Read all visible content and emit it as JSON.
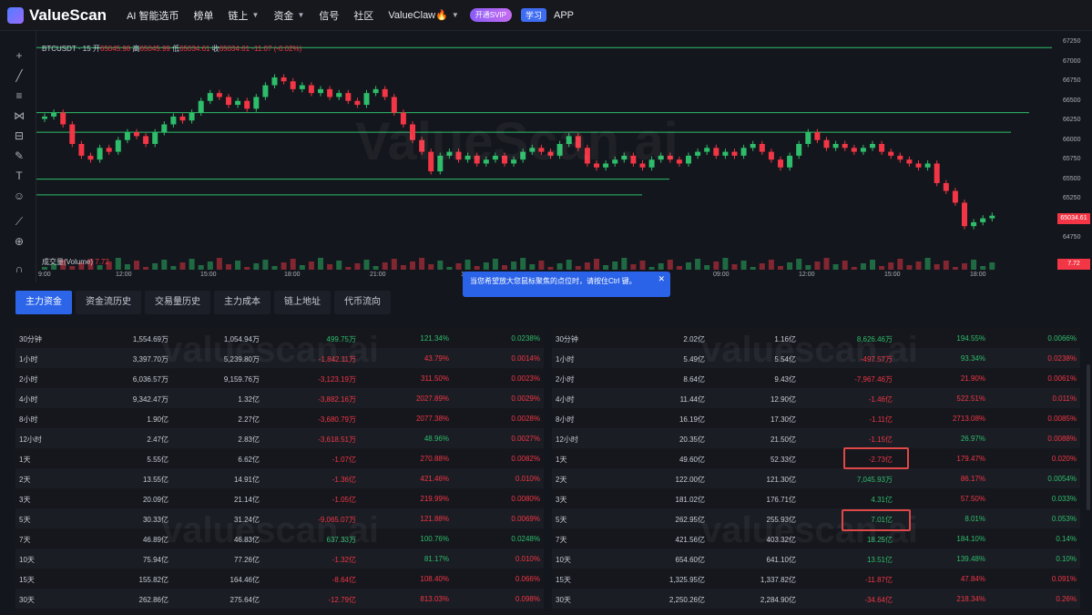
{
  "nav": {
    "logo": "ValueScan",
    "items": [
      "AI 智能选币",
      "榜单",
      "链上",
      "资金",
      "信号",
      "社区",
      "ValueClaw🔥"
    ],
    "vip": "开通SVIP",
    "learn": "学习",
    "app": "APP"
  },
  "chart": {
    "symbol": "BTCUSDT · 15",
    "open_label": "开",
    "open": "65045.98",
    "high_label": "高",
    "high": "65045.99",
    "low_label": "低",
    "low": "65034.61",
    "close_label": "收",
    "close": "65034.61",
    "change": "-11.07 (-0.02%)",
    "volume_label": "成交量(Volume)",
    "volume_value": "7.72",
    "watermark": "ValueScan.ai",
    "last_price": "65034.61",
    "vol_tag": "7.72",
    "x_ticks": [
      "9:00",
      "12:00",
      "15:00",
      "18:00",
      "21:00",
      "17",
      "03:00",
      "06:00",
      "09:00",
      "12:00",
      "15:00",
      "18:00"
    ],
    "y_ticks": [
      "67250",
      "67000",
      "66750",
      "66500",
      "66250",
      "66000",
      "65750",
      "65500",
      "65250",
      "64750"
    ],
    "tooltip": "当您希望放大您鼠标聚焦的点位时，请按住Ctrl 键。"
  },
  "chart_data": {
    "type": "candlestick",
    "ylim": [
      64600,
      67300
    ],
    "candles_close": [
      66300,
      66350,
      66200,
      65950,
      65800,
      65750,
      65900,
      65850,
      66000,
      66100,
      66050,
      65950,
      66100,
      66200,
      66300,
      66250,
      66350,
      66500,
      66600,
      66550,
      66450,
      66500,
      66400,
      66550,
      66700,
      66800,
      66750,
      66650,
      66700,
      66600,
      66650,
      66550,
      66600,
      66500,
      66450,
      66600,
      66650,
      66550,
      66350,
      66200,
      66000,
      65850,
      65600,
      65800,
      65850,
      65750,
      65800,
      65700,
      65750,
      65800,
      65700,
      65750,
      65850,
      65900,
      65850,
      65800,
      65950,
      66050,
      65900,
      65700,
      65650,
      65700,
      65750,
      65800,
      65700,
      65650,
      65750,
      65800,
      65750,
      65700,
      65800,
      65850,
      65900,
      65800,
      65850,
      65800,
      65900,
      65950,
      65850,
      65750,
      65650,
      65800,
      65950,
      66100,
      66000,
      65900,
      65950,
      65900,
      65850,
      65900,
      65950,
      65850,
      65800,
      65750,
      65700,
      65650,
      65700,
      65450,
      65350,
      65200,
      64900,
      64950,
      65000,
      65034
    ]
  },
  "tabs": [
    "主力资金",
    "资金流历史",
    "交易量历史",
    "主力成本",
    "链上地址",
    "代币流向"
  ],
  "left_table": [
    {
      "period": "30分钟",
      "a": "1,554.69万",
      "b": "1,054.94万",
      "c": "499.75万",
      "d": "121.34%",
      "e": "0.0238%",
      "cs": "pos",
      "ds": "pos",
      "es": "pos"
    },
    {
      "period": "1小时",
      "a": "3,397.70万",
      "b": "5,239.80万",
      "c": "-1,842.11万",
      "d": "43.79%",
      "e": "0.0014%",
      "cs": "neg",
      "ds": "neg",
      "es": "neg"
    },
    {
      "period": "2小时",
      "a": "6,036.57万",
      "b": "9,159.76万",
      "c": "-3,123.19万",
      "d": "311.50%",
      "e": "0.0023%",
      "cs": "neg",
      "ds": "neg",
      "es": "neg"
    },
    {
      "period": "4小时",
      "a": "9,342.47万",
      "b": "1.32亿",
      "c": "-3,882.16万",
      "d": "2027.89%",
      "e": "0.0029%",
      "cs": "neg",
      "ds": "neg",
      "es": "neg"
    },
    {
      "period": "8小时",
      "a": "1.90亿",
      "b": "2.27亿",
      "c": "-3,680.79万",
      "d": "2077.38%",
      "e": "0.0028%",
      "cs": "neg",
      "ds": "neg",
      "es": "neg"
    },
    {
      "period": "12小时",
      "a": "2.47亿",
      "b": "2.83亿",
      "c": "-3,618.51万",
      "d": "48.96%",
      "e": "0.0027%",
      "cs": "neg",
      "ds": "pos",
      "es": "neg"
    },
    {
      "period": "1天",
      "a": "5.55亿",
      "b": "6.62亿",
      "c": "-1.07亿",
      "d": "270.88%",
      "e": "0.0082%",
      "cs": "neg",
      "ds": "neg",
      "es": "neg"
    },
    {
      "period": "2天",
      "a": "13.55亿",
      "b": "14.91亿",
      "c": "-1.36亿",
      "d": "421.46%",
      "e": "0.010%",
      "cs": "neg",
      "ds": "neg",
      "es": "neg"
    },
    {
      "period": "3天",
      "a": "20.09亿",
      "b": "21.14亿",
      "c": "-1.05亿",
      "d": "219.99%",
      "e": "0.0080%",
      "cs": "neg",
      "ds": "neg",
      "es": "neg"
    },
    {
      "period": "5天",
      "a": "30.33亿",
      "b": "31.24亿",
      "c": "-9,065.07万",
      "d": "121.88%",
      "e": "0.0069%",
      "cs": "neg",
      "ds": "neg",
      "es": "neg"
    },
    {
      "period": "7天",
      "a": "46.89亿",
      "b": "46.83亿",
      "c": "637.33万",
      "d": "100.76%",
      "e": "0.0248%",
      "cs": "pos",
      "ds": "pos",
      "es": "pos"
    },
    {
      "period": "10天",
      "a": "75.94亿",
      "b": "77.26亿",
      "c": "-1.32亿",
      "d": "81.17%",
      "e": "0.010%",
      "cs": "neg",
      "ds": "pos",
      "es": "neg"
    },
    {
      "period": "15天",
      "a": "155.82亿",
      "b": "164.46亿",
      "c": "-8.64亿",
      "d": "108.40%",
      "e": "0.066%",
      "cs": "neg",
      "ds": "neg",
      "es": "neg"
    },
    {
      "period": "30天",
      "a": "262.86亿",
      "b": "275.64亿",
      "c": "-12.79亿",
      "d": "813.03%",
      "e": "0.098%",
      "cs": "neg",
      "ds": "neg",
      "es": "neg"
    }
  ],
  "right_table": [
    {
      "period": "30分钟",
      "a": "2.02亿",
      "b": "1.16亿",
      "c": "8,626.46万",
      "d": "194.55%",
      "e": "0.0066%",
      "cs": "pos",
      "ds": "pos",
      "es": "pos"
    },
    {
      "period": "1小时",
      "a": "5.49亿",
      "b": "5.54亿",
      "c": "-497.57万",
      "d": "93.34%",
      "e": "0.0238%",
      "cs": "neg",
      "ds": "pos",
      "es": "neg"
    },
    {
      "period": "2小时",
      "a": "8.64亿",
      "b": "9.43亿",
      "c": "-7,967.46万",
      "d": "21.90%",
      "e": "0.0061%",
      "cs": "neg",
      "ds": "neg",
      "es": "neg"
    },
    {
      "period": "4小时",
      "a": "11.44亿",
      "b": "12.90亿",
      "c": "-1.46亿",
      "d": "522.51%",
      "e": "0.011%",
      "cs": "neg",
      "ds": "neg",
      "es": "neg"
    },
    {
      "period": "8小时",
      "a": "16.19亿",
      "b": "17.30亿",
      "c": "-1.11亿",
      "d": "2713.08%",
      "e": "0.0085%",
      "cs": "neg",
      "ds": "neg",
      "es": "neg"
    },
    {
      "period": "12小时",
      "a": "20.35亿",
      "b": "21.50亿",
      "c": "-1.15亿",
      "d": "26.97%",
      "e": "0.0088%",
      "cs": "neg",
      "ds": "pos",
      "es": "neg"
    },
    {
      "period": "1天",
      "a": "49.60亿",
      "b": "52.33亿",
      "c": "-2.73亿",
      "d": "179.47%",
      "e": "0.020%",
      "cs": "neg",
      "ds": "neg",
      "es": "neg"
    },
    {
      "period": "2天",
      "a": "122.00亿",
      "b": "121.30亿",
      "c": "7,045.93万",
      "d": "86.17%",
      "e": "0.0054%",
      "cs": "pos",
      "ds": "neg",
      "es": "pos"
    },
    {
      "period": "3天",
      "a": "181.02亿",
      "b": "176.71亿",
      "c": "4.31亿",
      "d": "57.50%",
      "e": "0.033%",
      "cs": "pos",
      "ds": "neg",
      "es": "pos"
    },
    {
      "period": "5天",
      "a": "262.95亿",
      "b": "255.93亿",
      "c": "7.01亿",
      "d": "8.01%",
      "e": "0.053%",
      "cs": "pos",
      "ds": "pos",
      "es": "pos"
    },
    {
      "period": "7天",
      "a": "421.56亿",
      "b": "403.32亿",
      "c": "18.25亿",
      "d": "184.10%",
      "e": "0.14%",
      "cs": "pos",
      "ds": "pos",
      "es": "pos"
    },
    {
      "period": "10天",
      "a": "654.60亿",
      "b": "641.10亿",
      "c": "13.51亿",
      "d": "139.48%",
      "e": "0.10%",
      "cs": "pos",
      "ds": "pos",
      "es": "pos"
    },
    {
      "period": "15天",
      "a": "1,325.95亿",
      "b": "1,337.82亿",
      "c": "-11.87亿",
      "d": "47.84%",
      "e": "0.091%",
      "cs": "neg",
      "ds": "neg",
      "es": "neg"
    },
    {
      "period": "30天",
      "a": "2,250.26亿",
      "b": "2,284.90亿",
      "c": "-34.64亿",
      "d": "218.34%",
      "e": "0.26%",
      "cs": "neg",
      "ds": "neg",
      "es": "neg"
    }
  ],
  "table_watermark": "valuescan.ai"
}
